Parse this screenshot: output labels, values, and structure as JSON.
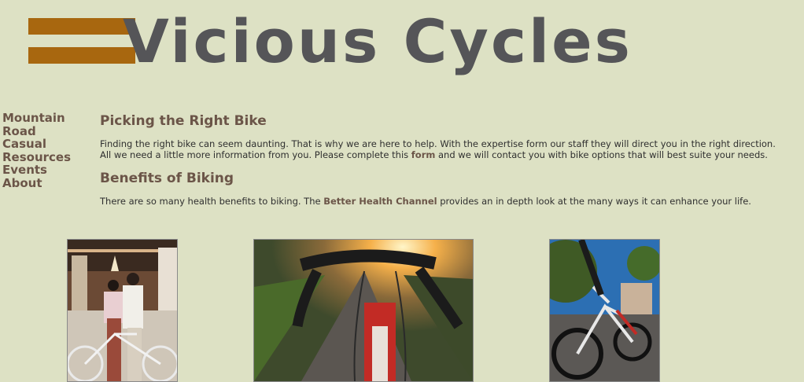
{
  "header": {
    "site_title": "Vicious Cycles"
  },
  "nav": {
    "items": [
      {
        "label": "Mountain"
      },
      {
        "label": "Road"
      },
      {
        "label": "Casual"
      },
      {
        "label": "Resources"
      },
      {
        "label": "Events"
      },
      {
        "label": "About"
      }
    ]
  },
  "sections": {
    "picking": {
      "heading": "Picking the Right Bike",
      "text_before": "Finding the right bike can seem daunting. That is why we are here to help. With the expertise form our staff they will direct you in the right direction. All we need a little more information from you. Please complete this ",
      "link": "form",
      "text_after": " and we will contact you with bike options that will best suite your needs."
    },
    "benefits": {
      "heading": "Benefits of Biking",
      "text_before": "There are so many health benefits to biking. The ",
      "link": "Better Health Channel",
      "text_after": " provides an in depth look at the many ways it can enhance your life."
    }
  },
  "colors": {
    "background": "#dde1c4",
    "accent_brown": "#6b5548",
    "logo_orange": "#a8670f",
    "logo_gray": "#555558"
  }
}
